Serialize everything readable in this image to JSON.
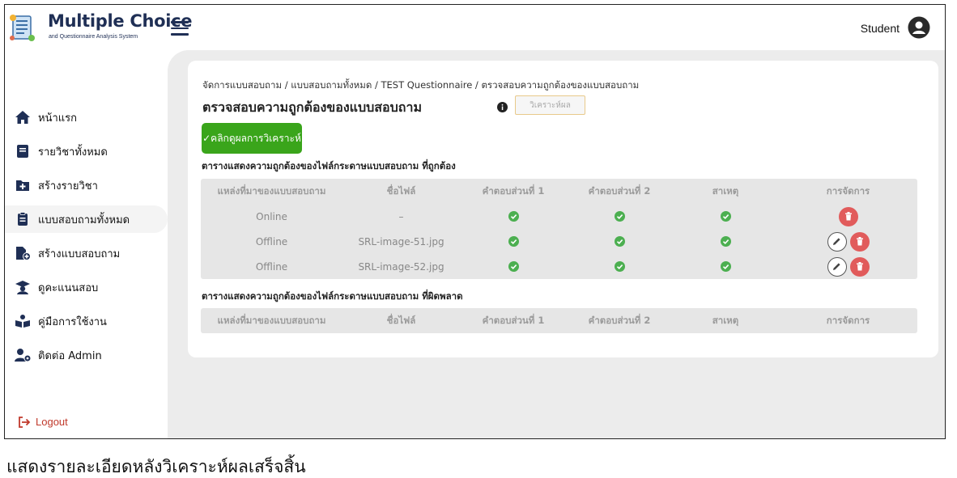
{
  "header": {
    "brand_title": "Multiple Choice",
    "brand_subtitle": "and Questionnaire Analysis System",
    "user_label": "Student"
  },
  "sidebar": {
    "items": [
      {
        "label": "หน้าแรก",
        "icon": "home-icon"
      },
      {
        "label": "รายวิชาทั้งหมด",
        "icon": "book-icon"
      },
      {
        "label": "สร้างรายวิชา",
        "icon": "folder-plus-icon"
      },
      {
        "label": "แบบสอบถามทั้งหมด",
        "icon": "clipboard-icon"
      },
      {
        "label": "สร้างแบบสอบถาม",
        "icon": "file-plus-icon"
      },
      {
        "label": "ดูคะแนนสอบ",
        "icon": "graduate-icon"
      },
      {
        "label": "คู่มือการใช้งาน",
        "icon": "reader-icon"
      },
      {
        "label": "ติดต่อ Admin",
        "icon": "user-gear-icon"
      }
    ],
    "active_index": 3,
    "logout_label": "Logout"
  },
  "main": {
    "breadcrumb": "จัดการแบบสอบถาม / แบบสอบถามทั้งหมด / TEST Questionnaire / ตรวจสอบความถูกต้องของแบบสอบถาม",
    "title": "ตรวจสอบความถูกต้องของแบบสอบถาม",
    "analyze_button": "วิเคราะห์ผล",
    "result_button": "✓คลิกดูผลการวิเคราะห์",
    "valid_section_title": "ตารางแสดงความถูกต้องของไฟล์กระดาษแบบสอบถาม ที่ถูกต้อง",
    "invalid_section_title": "ตารางแสดงความถูกต้องของไฟล์กระดาษแบบสอบถาม ที่ผิดพลาด",
    "columns": [
      "แหล่งที่มาของแบบสอบถาม",
      "ชื่อไฟล์",
      "คำตอบส่วนที่ 1",
      "คำตอบส่วนที่ 2",
      "สาเหตุ",
      "การจัดการ"
    ],
    "valid_rows": [
      {
        "source": "Online",
        "filename": "–",
        "part1": true,
        "part2": true,
        "reason": true,
        "actions": [
          "delete"
        ]
      },
      {
        "source": "Offline",
        "filename": "SRL-image-51.jpg",
        "part1": true,
        "part2": true,
        "reason": true,
        "actions": [
          "edit",
          "delete"
        ]
      },
      {
        "source": "Offline",
        "filename": "SRL-image-52.jpg",
        "part1": true,
        "part2": true,
        "reason": true,
        "actions": [
          "edit",
          "delete"
        ]
      }
    ],
    "colors": {
      "accent_green": "#3aa51b",
      "check_green": "#4caf50",
      "delete_red": "#e15b5b"
    }
  },
  "caption": "แสดงรายละเอียดหลังวิเคราะห์ผลเสร็จสิ้น"
}
